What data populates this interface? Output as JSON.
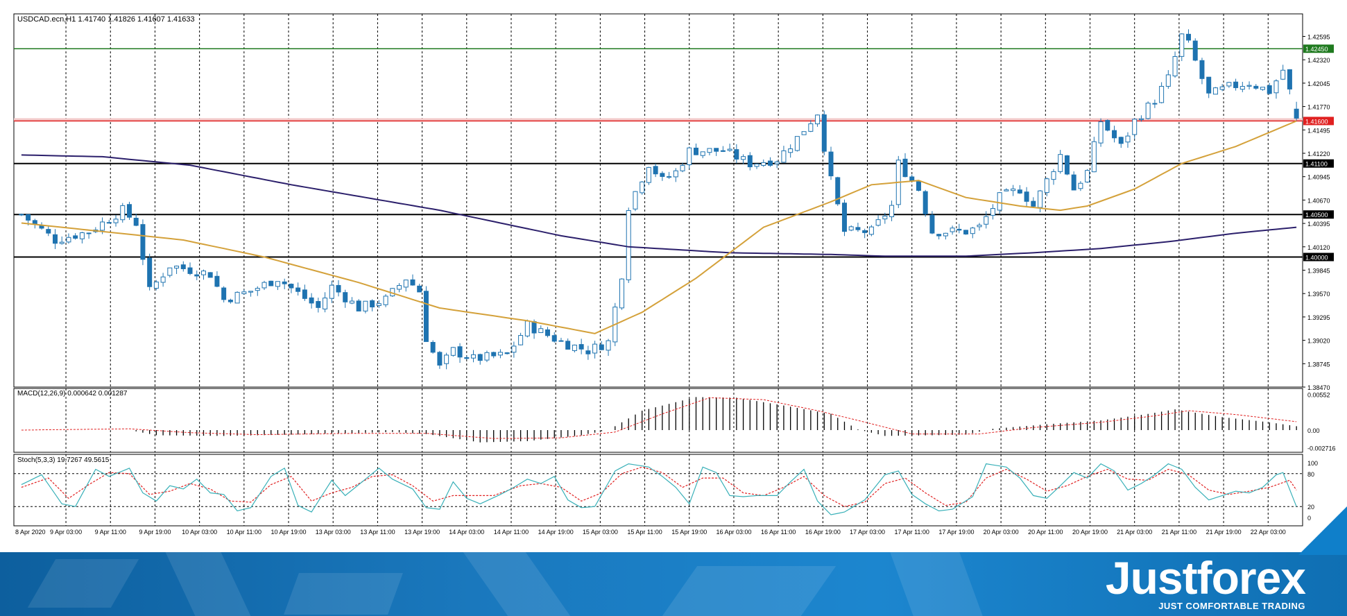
{
  "header": {
    "symbol_info": "USDCAD.ecn,H1  1.41740 1.41826 1.41607 1.41633"
  },
  "colors": {
    "bull": "#ffffff",
    "bear": "#1e73b0",
    "candle_outline": "#1e73b0",
    "ma_fast": "#d4a13a",
    "ma_slow": "#2b1f6b",
    "green_level": "#1f7a1f",
    "red_level": "#e02020",
    "black_level": "#000000",
    "macd_signal": "#e02020",
    "stoch_main": "#38b0b8",
    "stoch_signal": "#e02020"
  },
  "chart_data": {
    "type": "candlestick",
    "symbol": "USDCAD.ecn",
    "timeframe": "H1",
    "ohlc_header": {
      "open": 1.4174,
      "high": 1.41826,
      "low": 1.41607,
      "close": 1.41633
    },
    "price_axis": {
      "ticks": [
        "1.42595",
        "1.42320",
        "1.42045",
        "1.41770",
        "1.41495",
        "1.41220",
        "1.40945",
        "1.40670",
        "1.40395",
        "1.40120",
        "1.39845",
        "1.39570",
        "1.39295",
        "1.39020",
        "1.38745",
        "1.38470"
      ],
      "range": [
        1.3847,
        1.4286
      ]
    },
    "levels": [
      {
        "label": "1.42450",
        "value": 1.4245,
        "color": "green"
      },
      {
        "label": "1.41600",
        "value": 1.416,
        "color": "red"
      },
      {
        "label": "1.41100",
        "value": 1.411,
        "color": "black"
      },
      {
        "label": "1.40500",
        "value": 1.405,
        "color": "black"
      },
      {
        "label": "1.40000",
        "value": 1.4,
        "color": "black"
      }
    ],
    "time_axis": [
      "8 Apr 2020",
      "9 Apr 03:00",
      "9 Apr 11:00",
      "9 Apr 19:00",
      "10 Apr 03:00",
      "10 Apr 11:00",
      "10 Apr 19:00",
      "13 Apr 03:00",
      "13 Apr 11:00",
      "13 Apr 19:00",
      "14 Apr 03:00",
      "14 Apr 11:00",
      "14 Apr 19:00",
      "15 Apr 03:00",
      "15 Apr 11:00",
      "15 Apr 19:00",
      "16 Apr 03:00",
      "16 Apr 11:00",
      "16 Apr 19:00",
      "17 Apr 03:00",
      "17 Apr 11:00",
      "17 Apr 19:00",
      "20 Apr 03:00",
      "20 Apr 11:00",
      "20 Apr 19:00",
      "21 Apr 03:00",
      "21 Apr 11:00",
      "21 Apr 19:00",
      "22 Apr 03:00"
    ],
    "close_anchors": [
      [
        0,
        1.405
      ],
      [
        5,
        1.402
      ],
      [
        10,
        1.403
      ],
      [
        15,
        1.4055
      ],
      [
        17,
        1.404
      ],
      [
        19,
        1.396
      ],
      [
        22,
        1.399
      ],
      [
        25,
        1.3985
      ],
      [
        28,
        1.398
      ],
      [
        30,
        1.395
      ],
      [
        34,
        1.396
      ],
      [
        38,
        1.3975
      ],
      [
        44,
        1.394
      ],
      [
        46,
        1.3965
      ],
      [
        50,
        1.394
      ],
      [
        54,
        1.395
      ],
      [
        57,
        1.3975
      ],
      [
        59,
        1.396
      ],
      [
        60,
        1.3905
      ],
      [
        62,
        1.387
      ],
      [
        64,
        1.389
      ],
      [
        67,
        1.388
      ],
      [
        72,
        1.3885
      ],
      [
        75,
        1.392
      ],
      [
        80,
        1.39
      ],
      [
        84,
        1.389
      ],
      [
        87,
        1.39
      ],
      [
        89,
        1.398
      ],
      [
        90,
        1.406
      ],
      [
        93,
        1.411
      ],
      [
        95,
        1.409
      ],
      [
        97,
        1.41
      ],
      [
        99,
        1.4125
      ],
      [
        104,
        1.4125
      ],
      [
        108,
        1.411
      ],
      [
        112,
        1.4115
      ],
      [
        115,
        1.414
      ],
      [
        118,
        1.417
      ],
      [
        119,
        1.413
      ],
      [
        120,
        1.409
      ],
      [
        122,
        1.403
      ],
      [
        126,
        1.403
      ],
      [
        129,
        1.406
      ],
      [
        130,
        1.411
      ],
      [
        133,
        1.408
      ],
      [
        135,
        1.403
      ],
      [
        140,
        1.403
      ],
      [
        142,
        1.4035
      ],
      [
        145,
        1.407
      ],
      [
        148,
        1.408
      ],
      [
        150,
        1.406
      ],
      [
        152,
        1.409
      ],
      [
        154,
        1.412
      ],
      [
        156,
        1.408
      ],
      [
        158,
        1.41
      ],
      [
        160,
        1.416
      ],
      [
        163,
        1.413
      ],
      [
        165,
        1.416
      ],
      [
        168,
        1.4185
      ],
      [
        170,
        1.421
      ],
      [
        172,
        1.426
      ],
      [
        173,
        1.425
      ],
      [
        174,
        1.423
      ],
      [
        176,
        1.419
      ],
      [
        179,
        1.42
      ],
      [
        182,
        1.4205
      ],
      [
        185,
        1.4195
      ],
      [
        187,
        1.422
      ],
      [
        188,
        1.4195
      ],
      [
        189,
        1.4163
      ]
    ],
    "ma_fast": [
      [
        0,
        1.404
      ],
      [
        24,
        1.402
      ],
      [
        36,
        1.4
      ],
      [
        50,
        1.397
      ],
      [
        62,
        1.394
      ],
      [
        75,
        1.3925
      ],
      [
        85,
        1.391
      ],
      [
        92,
        1.3935
      ],
      [
        100,
        1.3975
      ],
      [
        110,
        1.4035
      ],
      [
        120,
        1.4065
      ],
      [
        126,
        1.4085
      ],
      [
        133,
        1.409
      ],
      [
        140,
        1.407
      ],
      [
        148,
        1.406
      ],
      [
        154,
        1.4055
      ],
      [
        158,
        1.406
      ],
      [
        165,
        1.408
      ],
      [
        172,
        1.411
      ],
      [
        180,
        1.413
      ],
      [
        189,
        1.416
      ]
    ],
    "ma_slow": [
      [
        0,
        1.412
      ],
      [
        12,
        1.4118
      ],
      [
        25,
        1.4108
      ],
      [
        40,
        1.4085
      ],
      [
        62,
        1.4055
      ],
      [
        80,
        1.4025
      ],
      [
        90,
        1.4012
      ],
      [
        105,
        1.4005
      ],
      [
        120,
        1.4003
      ],
      [
        128,
        1.4001
      ],
      [
        140,
        1.4001
      ],
      [
        150,
        1.4005
      ],
      [
        160,
        1.401
      ],
      [
        170,
        1.4018
      ],
      [
        180,
        1.4028
      ],
      [
        189,
        1.4035
      ]
    ],
    "macd": {
      "label": "MACD(12,26,9) 0.000642 0.001287",
      "ticks": [
        "0.00552",
        "0.00",
        "-0.002716"
      ],
      "range": [
        -0.003,
        0.006
      ],
      "hist_anchors": [
        [
          0,
          0.0
        ],
        [
          16,
          0.0
        ],
        [
          20,
          -0.0008
        ],
        [
          30,
          -0.0009
        ],
        [
          40,
          -0.0007
        ],
        [
          55,
          -0.0003
        ],
        [
          60,
          -0.0006
        ],
        [
          68,
          -0.0019
        ],
        [
          75,
          -0.0017
        ],
        [
          83,
          -0.0008
        ],
        [
          87,
          0.0
        ],
        [
          92,
          0.003
        ],
        [
          100,
          0.0051
        ],
        [
          106,
          0.005
        ],
        [
          113,
          0.0038
        ],
        [
          120,
          0.0025
        ],
        [
          124,
          0.0001
        ],
        [
          128,
          -0.0009
        ],
        [
          135,
          -0.0008
        ],
        [
          140,
          -0.0007
        ],
        [
          144,
          0.0002
        ],
        [
          152,
          0.0009
        ],
        [
          160,
          0.0015
        ],
        [
          167,
          0.0025
        ],
        [
          171,
          0.0032
        ],
        [
          178,
          0.002
        ],
        [
          185,
          0.0012
        ],
        [
          189,
          0.0006
        ]
      ],
      "signal_anchors": [
        [
          0,
          0.0
        ],
        [
          16,
          0.0002
        ],
        [
          25,
          -0.0004
        ],
        [
          35,
          -0.0007
        ],
        [
          50,
          -0.0005
        ],
        [
          60,
          -0.0005
        ],
        [
          70,
          -0.0013
        ],
        [
          80,
          -0.0012
        ],
        [
          88,
          -0.0003
        ],
        [
          95,
          0.0025
        ],
        [
          102,
          0.005
        ],
        [
          110,
          0.0047
        ],
        [
          118,
          0.003
        ],
        [
          124,
          0.0015
        ],
        [
          132,
          -0.0006
        ],
        [
          142,
          -0.0006
        ],
        [
          150,
          0.0004
        ],
        [
          160,
          0.0012
        ],
        [
          168,
          0.0022
        ],
        [
          173,
          0.003
        ],
        [
          180,
          0.0024
        ],
        [
          189,
          0.0013
        ]
      ]
    },
    "stoch": {
      "label": "Stoch(5,3,3) 19.7267 49.5615",
      "ticks": [
        "100",
        "80",
        "20",
        "0"
      ],
      "range": [
        0,
        100
      ],
      "main_anchors": [
        [
          0,
          60
        ],
        [
          3,
          78
        ],
        [
          6,
          25
        ],
        [
          8,
          20
        ],
        [
          11,
          88
        ],
        [
          13,
          75
        ],
        [
          16,
          90
        ],
        [
          18,
          45
        ],
        [
          20,
          30
        ],
        [
          22,
          58
        ],
        [
          24,
          52
        ],
        [
          26,
          70
        ],
        [
          28,
          45
        ],
        [
          30,
          42
        ],
        [
          32,
          12
        ],
        [
          34,
          18
        ],
        [
          37,
          75
        ],
        [
          39,
          90
        ],
        [
          41,
          22
        ],
        [
          43,
          10
        ],
        [
          46,
          68
        ],
        [
          48,
          40
        ],
        [
          50,
          60
        ],
        [
          53,
          90
        ],
        [
          55,
          70
        ],
        [
          58,
          52
        ],
        [
          60,
          18
        ],
        [
          62,
          15
        ],
        [
          64,
          65
        ],
        [
          66,
          35
        ],
        [
          68,
          25
        ],
        [
          71,
          42
        ],
        [
          73,
          55
        ],
        [
          75,
          70
        ],
        [
          77,
          62
        ],
        [
          79,
          75
        ],
        [
          81,
          32
        ],
        [
          83,
          18
        ],
        [
          85,
          20
        ],
        [
          88,
          85
        ],
        [
          90,
          98
        ],
        [
          93,
          92
        ],
        [
          95,
          75
        ],
        [
          97,
          55
        ],
        [
          99,
          25
        ],
        [
          101,
          92
        ],
        [
          103,
          82
        ],
        [
          105,
          40
        ],
        [
          107,
          38
        ],
        [
          109,
          40
        ],
        [
          112,
          40
        ],
        [
          114,
          65
        ],
        [
          116,
          88
        ],
        [
          118,
          30
        ],
        [
          120,
          5
        ],
        [
          122,
          10
        ],
        [
          125,
          32
        ],
        [
          128,
          78
        ],
        [
          130,
          85
        ],
        [
          132,
          42
        ],
        [
          134,
          25
        ],
        [
          136,
          12
        ],
        [
          138,
          15
        ],
        [
          141,
          38
        ],
        [
          143,
          98
        ],
        [
          146,
          92
        ],
        [
          148,
          72
        ],
        [
          150,
          40
        ],
        [
          152,
          35
        ],
        [
          154,
          58
        ],
        [
          156,
          82
        ],
        [
          158,
          72
        ],
        [
          160,
          98
        ],
        [
          162,
          85
        ],
        [
          164,
          50
        ],
        [
          166,
          62
        ],
        [
          168,
          78
        ],
        [
          170,
          98
        ],
        [
          172,
          88
        ],
        [
          174,
          55
        ],
        [
          176,
          32
        ],
        [
          178,
          40
        ],
        [
          180,
          48
        ],
        [
          182,
          45
        ],
        [
          184,
          55
        ],
        [
          186,
          78
        ],
        [
          187,
          82
        ],
        [
          189,
          20
        ]
      ],
      "signal_anchors": [
        [
          0,
          55
        ],
        [
          4,
          72
        ],
        [
          7,
          35
        ],
        [
          10,
          60
        ],
        [
          13,
          82
        ],
        [
          16,
          80
        ],
        [
          19,
          42
        ],
        [
          22,
          48
        ],
        [
          25,
          62
        ],
        [
          28,
          52
        ],
        [
          31,
          30
        ],
        [
          34,
          28
        ],
        [
          37,
          60
        ],
        [
          40,
          75
        ],
        [
          43,
          30
        ],
        [
          46,
          45
        ],
        [
          49,
          55
        ],
        [
          52,
          75
        ],
        [
          55,
          78
        ],
        [
          58,
          58
        ],
        [
          61,
          30
        ],
        [
          64,
          40
        ],
        [
          67,
          40
        ],
        [
          70,
          40
        ],
        [
          74,
          58
        ],
        [
          77,
          62
        ],
        [
          80,
          55
        ],
        [
          83,
          30
        ],
        [
          86,
          45
        ],
        [
          89,
          80
        ],
        [
          92,
          92
        ],
        [
          95,
          82
        ],
        [
          98,
          55
        ],
        [
          101,
          72
        ],
        [
          104,
          72
        ],
        [
          107,
          45
        ],
        [
          110,
          40
        ],
        [
          113,
          55
        ],
        [
          116,
          75
        ],
        [
          119,
          40
        ],
        [
          122,
          20
        ],
        [
          125,
          28
        ],
        [
          128,
          62
        ],
        [
          131,
          72
        ],
        [
          134,
          45
        ],
        [
          137,
          22
        ],
        [
          140,
          28
        ],
        [
          143,
          72
        ],
        [
          146,
          88
        ],
        [
          149,
          70
        ],
        [
          152,
          48
        ],
        [
          155,
          58
        ],
        [
          158,
          75
        ],
        [
          161,
          88
        ],
        [
          164,
          70
        ],
        [
          167,
          68
        ],
        [
          170,
          88
        ],
        [
          173,
          78
        ],
        [
          176,
          50
        ],
        [
          179,
          42
        ],
        [
          182,
          48
        ],
        [
          185,
          55
        ],
        [
          188,
          68
        ],
        [
          189,
          50
        ]
      ]
    }
  },
  "branding": {
    "logo": "Justforex",
    "tagline": "JUST COMFORTABLE TRADING"
  }
}
